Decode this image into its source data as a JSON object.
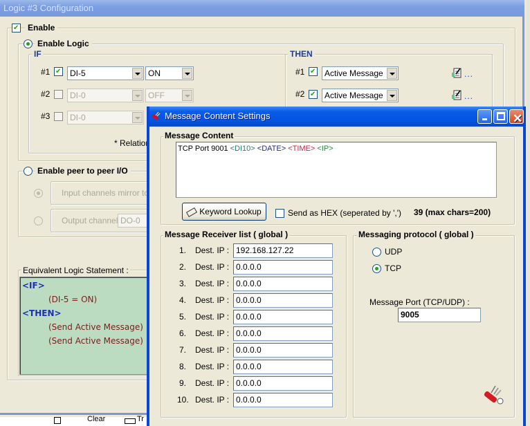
{
  "background_window": {
    "title": "Logic #3 Configuration",
    "enable_checkbox": {
      "label": "Enable",
      "checked": true
    },
    "enable_logic_radio": {
      "label": "Enable Logic",
      "selected": true
    },
    "if_group": {
      "title": "IF",
      "rows": [
        {
          "index": "#1",
          "checked": true,
          "channel": "DI-5",
          "state": "ON",
          "enabled": true
        },
        {
          "index": "#2",
          "checked": false,
          "channel": "DI-0",
          "state": "OFF",
          "enabled": false
        },
        {
          "index": "#3",
          "checked": false,
          "channel": "DI-0",
          "state": "",
          "enabled": false
        }
      ],
      "relation_note": "* Relation"
    },
    "then_group": {
      "title": "THEN",
      "rows": [
        {
          "index": "#1",
          "checked": true,
          "action": "Active Message",
          "more_label": "..."
        },
        {
          "index": "#2",
          "checked": true,
          "action": "Active Message",
          "more_label": "..."
        }
      ]
    },
    "peer_to_peer": {
      "label": "Enable peer to peer I/O",
      "selected": false,
      "input_mirror_label": "Input channels mirror to",
      "output_channel_label": "Output channel",
      "output_channel_value": "DO-0"
    },
    "equivalent_logic": {
      "title": "Equivalent Logic Statement :",
      "lines": [
        {
          "type": "keyword",
          "text": "<IF>"
        },
        {
          "type": "text",
          "text": "(DI-5 = ON)"
        },
        {
          "type": "keyword",
          "text": "<THEN>"
        },
        {
          "type": "text",
          "text": "(Send Active Message)"
        },
        {
          "type": "text",
          "text": "(Send Active Message)"
        }
      ]
    },
    "behind_partial_labels": {
      "clear": "Clear",
      "tr": "Tr"
    }
  },
  "dialog": {
    "title": "Message Content Settings",
    "message_content": {
      "title": "Message Content",
      "segments": [
        {
          "text": "TCP Port 9001 ",
          "color": "#000000"
        },
        {
          "text": "<DI10>",
          "color": "#2a7a6a"
        },
        {
          "text": " ",
          "color": "#000000"
        },
        {
          "text": "<DATE>",
          "color": "#1e2a8a"
        },
        {
          "text": " ",
          "color": "#000000"
        },
        {
          "text": "<TIME>",
          "color": "#d02040"
        },
        {
          "text": " ",
          "color": "#000000"
        },
        {
          "text": "<IP>",
          "color": "#1f8a3a"
        }
      ],
      "keyword_lookup_label": "Keyword Lookup",
      "send_hex_label": "Send as HEX (seperated by ',')",
      "send_hex_checked": false,
      "char_count": "39 (max chars=200)"
    },
    "receiver_list": {
      "title": "Message Receiver list ( global )",
      "dest_label": "Dest. IP :",
      "items": [
        {
          "index": "1.",
          "ip": "192.168.127.22"
        },
        {
          "index": "2.",
          "ip": "0.0.0.0"
        },
        {
          "index": "3.",
          "ip": "0.0.0.0"
        },
        {
          "index": "4.",
          "ip": "0.0.0.0"
        },
        {
          "index": "5.",
          "ip": "0.0.0.0"
        },
        {
          "index": "6.",
          "ip": "0.0.0.0"
        },
        {
          "index": "7.",
          "ip": "0.0.0.0"
        },
        {
          "index": "8.",
          "ip": "0.0.0.0"
        },
        {
          "index": "9.",
          "ip": "0.0.0.0"
        },
        {
          "index": "10.",
          "ip": "0.0.0.0"
        }
      ]
    },
    "protocol": {
      "title": "Messaging protocol ( global )",
      "options": [
        {
          "label": "UDP",
          "selected": false
        },
        {
          "label": "TCP",
          "selected": true
        }
      ],
      "port_label": "Message Port (TCP/UDP) :",
      "port_value": "9005"
    }
  }
}
